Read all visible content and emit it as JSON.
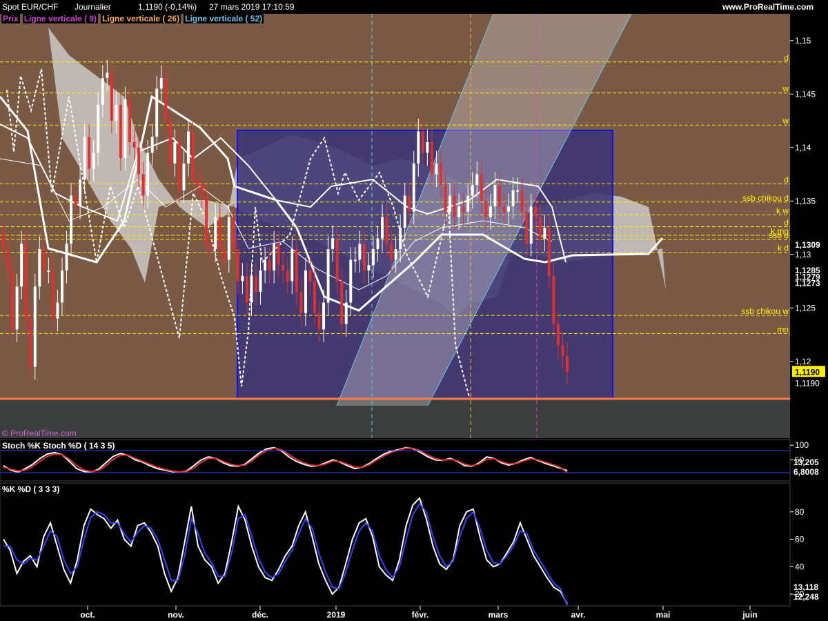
{
  "header": {
    "instrument": "Spot EUR/CHF",
    "timeframe": "Journalier",
    "last_quote": "1,1190 (-0,14%)",
    "datetime": "27 mars 2019 17:10:59",
    "website": "www.ProRealTime.com",
    "watermark": "© ProRealTime.com"
  },
  "legend": {
    "price": "Prix",
    "vline1": "Ligne verticale ( 9)",
    "vline2": "Ligne verticale ( 26)",
    "vline3": "Ligne verticale ( 52)"
  },
  "colors": {
    "price_bg": "#7a5a45",
    "lower_band": "#3b3f3d",
    "rect_fill": "#3c3575",
    "rect_border": "#1111ee",
    "cloud": "#d8d8d8",
    "level_line": "#ffee00",
    "bear_candle": "#e03030",
    "bull_candle": "#ffffff",
    "support_line": "#ff7a45",
    "vline_cyan": "#66c6ee",
    "vline_orange": "#ffae40",
    "vline_magenta": "#e040e0"
  },
  "chart_data": [
    {
      "type": "candlestick",
      "title": "Spot EUR/CHF Journalier",
      "ylim": [
        1.1165,
        1.1525
      ],
      "y_ticks": [
        "1,15",
        "1,145",
        "1,14",
        "1,135",
        "1,13",
        "1,125",
        "1,12"
      ],
      "x_ticks": [
        "oct.",
        "nov.",
        "déc.",
        "2019",
        "févr.",
        "mars",
        "avr.",
        "mai",
        "juin"
      ],
      "price_labels": [
        "1,1309",
        "1,1285",
        "1,1279",
        "1,1273",
        "1,1190"
      ],
      "last_price": "1,1190",
      "last_price_value": 1.119,
      "support_level": 1.1195,
      "levels": [
        {
          "label": "d",
          "value": 1.148
        },
        {
          "label": "w",
          "value": 1.1451
        },
        {
          "label": "w",
          "value": 1.1421
        },
        {
          "label": "d",
          "value": 1.1366
        },
        {
          "label": "ssb chikou d",
          "value": 1.1349
        },
        {
          "label": "k w",
          "value": 1.1337
        },
        {
          "label": "d",
          "value": 1.1326
        },
        {
          "label": "k mn",
          "value": 1.1318
        },
        {
          "label": "ssb d",
          "value": 1.1314
        },
        {
          "label": "k d",
          "value": 1.1302
        },
        {
          "label": "ssb chikou w",
          "value": 1.1243
        },
        {
          "label": "mn",
          "value": 1.1226
        }
      ],
      "series": [
        {
          "name": "Prix",
          "close": [
            1.1305,
            1.1285,
            1.123,
            1.127,
            1.131,
            1.124,
            1.1195,
            1.127,
            1.1305,
            1.1285,
            1.1285,
            1.124,
            1.1255,
            1.1285,
            1.131,
            1.1355,
            1.1345,
            1.137,
            1.141,
            1.138,
            1.1395,
            1.144,
            1.1465,
            1.147,
            1.1425,
            1.144,
            1.139,
            1.1445,
            1.1405,
            1.14,
            1.1375,
            1.1355,
            1.1395,
            1.141,
            1.1455,
            1.1465,
            1.1425,
            1.1385,
            1.1405,
            1.136,
            1.1385,
            1.1415,
            1.137,
            1.1365,
            1.1355,
            1.131,
            1.1305,
            1.1335,
            1.1305,
            1.1295,
            1.1335,
            1.1305,
            1.1275,
            1.128,
            1.1255,
            1.128,
            1.1265,
            1.1285,
            1.1295,
            1.1285,
            1.131,
            1.129,
            1.1285,
            1.1275,
            1.1305,
            1.1265,
            1.1245,
            1.1285,
            1.1275,
            1.1245,
            1.123,
            1.1255,
            1.1305,
            1.1315,
            1.1275,
            1.1235,
            1.1255,
            1.1295,
            1.1295,
            1.131,
            1.1285,
            1.129,
            1.1305,
            1.1315,
            1.1335,
            1.131,
            1.1295,
            1.1305,
            1.1325,
            1.1355,
            1.134,
            1.1385,
            1.1415,
            1.1395,
            1.1405,
            1.1375,
            1.1385,
            1.1365,
            1.134,
            1.1355,
            1.1335,
            1.1345,
            1.134,
            1.1355,
            1.1365,
            1.1375,
            1.135,
            1.1335,
            1.1345,
            1.1365,
            1.1345,
            1.134,
            1.1345,
            1.136,
            1.136,
            1.134,
            1.131,
            1.1345,
            1.1335,
            1.1315,
            1.1325,
            1.128,
            1.1235,
            1.1215,
            1.1205,
            1.119
          ]
        }
      ]
    },
    {
      "type": "line",
      "title": "Stoch %K Stoch %D ( 14 3 5)",
      "y_ticks": [
        "100",
        "50"
      ],
      "ylim": [
        -15,
        110
      ],
      "last_values": [
        "13,205",
        "6,8008"
      ],
      "series": [
        {
          "name": "Stoch %K",
          "values": [
            30,
            15,
            8,
            20,
            35,
            55,
            70,
            75,
            68,
            45,
            20,
            10,
            8,
            18,
            40,
            62,
            72,
            65,
            50,
            42,
            30,
            20,
            15,
            10,
            7,
            12,
            30,
            50,
            60,
            55,
            40,
            30,
            28,
            35,
            55,
            75,
            88,
            92,
            80,
            60,
            45,
            35,
            28,
            30,
            40,
            50,
            42,
            30,
            20,
            25,
            38,
            55,
            70,
            80,
            85,
            92,
            88,
            75,
            60,
            50,
            48,
            55,
            45,
            30,
            28,
            40,
            60,
            55,
            40,
            32,
            38,
            50,
            58,
            48,
            38,
            30,
            22,
            13
          ]
        },
        {
          "name": "Stoch %D",
          "values": [
            25,
            18,
            12,
            15,
            28,
            45,
            62,
            70,
            68,
            52,
            30,
            15,
            10,
            14,
            30,
            52,
            66,
            66,
            55,
            45,
            35,
            25,
            18,
            12,
            9,
            10,
            22,
            42,
            55,
            56,
            45,
            35,
            30,
            32,
            48,
            68,
            82,
            90,
            84,
            68,
            52,
            40,
            32,
            30,
            36,
            46,
            44,
            35,
            25,
            24,
            34,
            50,
            64,
            76,
            83,
            90,
            89,
            80,
            66,
            54,
            49,
            52,
            47,
            35,
            30,
            36,
            52,
            54,
            44,
            36,
            37,
            46,
            54,
            50,
            42,
            34,
            25,
            7
          ]
        }
      ]
    },
    {
      "type": "line",
      "title": "%K %D ( 3 3 3)",
      "y_ticks": [
        "80",
        "60",
        "40",
        "20"
      ],
      "ylim": [
        13,
        95
      ],
      "last_values": [
        "13,118",
        "12,248"
      ],
      "series": [
        {
          "name": "%K",
          "values": [
            60,
            52,
            35,
            44,
            48,
            40,
            62,
            72,
            55,
            38,
            28,
            45,
            70,
            82,
            78,
            75,
            68,
            74,
            60,
            55,
            70,
            72,
            65,
            55,
            35,
            22,
            32,
            58,
            84,
            55,
            45,
            40,
            28,
            35,
            58,
            84,
            74,
            55,
            40,
            32,
            30,
            38,
            48,
            55,
            70,
            80,
            62,
            42,
            30,
            20,
            25,
            42,
            60,
            72,
            75,
            62,
            40,
            34,
            30,
            45,
            70,
            85,
            90,
            75,
            55,
            42,
            38,
            45,
            70,
            80,
            82,
            62,
            45,
            40,
            42,
            50,
            58,
            72,
            60,
            48,
            40,
            32,
            25,
            22,
            13
          ]
        },
        {
          "name": "%D",
          "values": [
            55,
            55,
            45,
            42,
            46,
            45,
            55,
            66,
            62,
            45,
            35,
            40,
            60,
            76,
            80,
            78,
            72,
            72,
            64,
            58,
            65,
            70,
            68,
            60,
            45,
            30,
            30,
            48,
            75,
            64,
            50,
            43,
            33,
            33,
            50,
            75,
            78,
            62,
            46,
            36,
            32,
            35,
            44,
            52,
            64,
            75,
            68,
            50,
            36,
            25,
            24,
            36,
            52,
            66,
            72,
            66,
            48,
            38,
            32,
            40,
            60,
            78,
            86,
            80,
            62,
            48,
            40,
            44,
            62,
            75,
            80,
            68,
            52,
            43,
            42,
            48,
            55,
            66,
            64,
            52,
            44,
            36,
            28,
            24,
            12
          ]
        }
      ]
    }
  ]
}
